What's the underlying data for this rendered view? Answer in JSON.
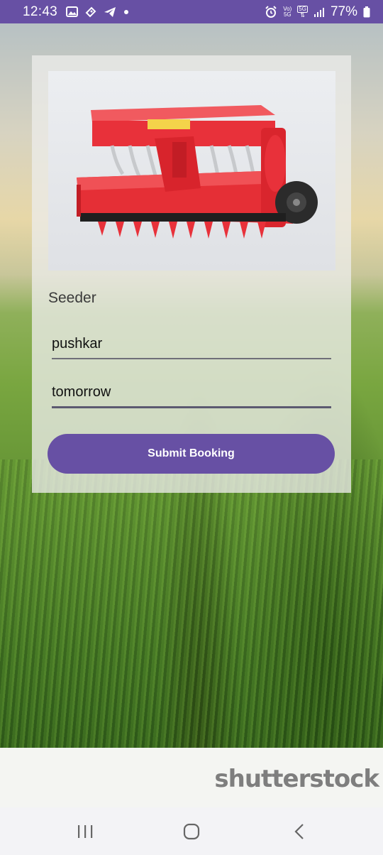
{
  "status_bar": {
    "time": "12:43",
    "network_top": "Vo)",
    "network_bottom": "5G",
    "network2_top": "5G",
    "battery": "77%"
  },
  "product": {
    "name": "Seeder",
    "image_icon": "red-seeder-machine"
  },
  "form": {
    "name_value": "pushkar",
    "date_value": "tomorrow",
    "submit_label": "Submit Booking"
  },
  "background": {
    "watermark": "shutterstock"
  },
  "colors": {
    "accent": "#6750a4",
    "machine_red": "#e8313a"
  },
  "nav": {
    "icons": [
      "recent-apps-icon",
      "home-icon",
      "back-icon"
    ]
  }
}
